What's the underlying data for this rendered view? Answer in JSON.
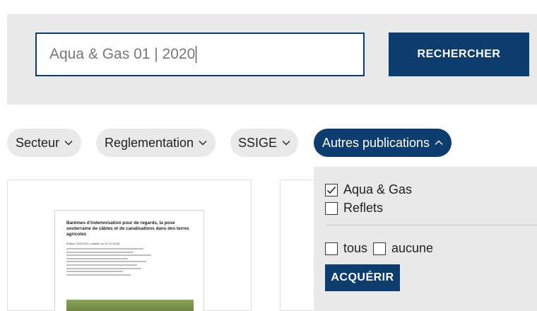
{
  "search": {
    "value": "Aqua & Gas 01 | 2020",
    "button_label": "RECHERCHER"
  },
  "filters": [
    {
      "label": "Secteur",
      "expanded": false
    },
    {
      "label": "Reglementation",
      "expanded": false
    },
    {
      "label": "SSIGE",
      "expanded": false
    },
    {
      "label": "Autres publications",
      "expanded": true
    }
  ],
  "dropdown": {
    "options": [
      {
        "label": "Aqua & Gas",
        "checked": true
      },
      {
        "label": "Reflets",
        "checked": false
      }
    ],
    "select_all_label": "tous",
    "select_none_label": "aucune",
    "acquire_label": "ACQUÉRIR"
  },
  "card": {
    "doc_title": "Barèmes d'indemnisation pour de regards, la pose souterraine de câbles et de canalisations dans des terres agricoles",
    "doc_edition": "Édition 2020/2021 (valable au 31.12.2024)"
  },
  "colors": {
    "primary": "#0d3c6e",
    "band": "#e8e9e8"
  }
}
